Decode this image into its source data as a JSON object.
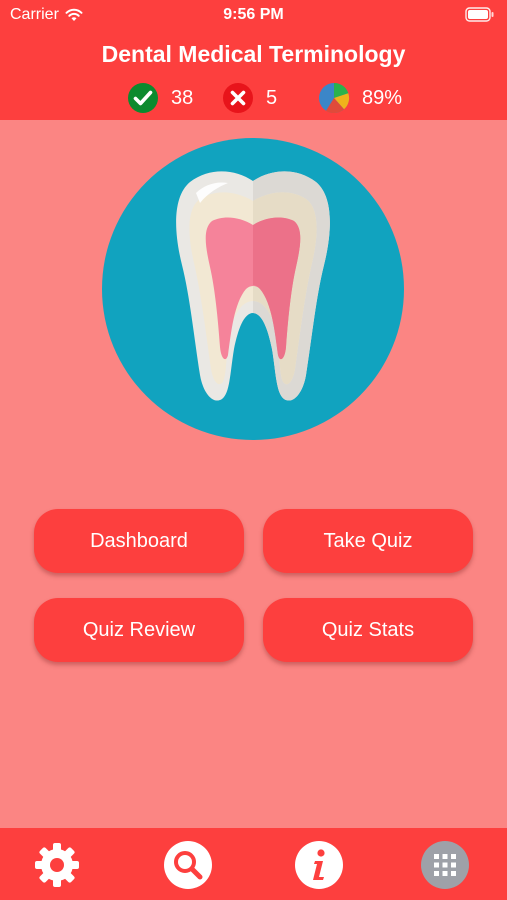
{
  "status_bar": {
    "carrier": "Carrier",
    "time": "9:56 PM"
  },
  "header": {
    "title": "Dental Medical Terminology",
    "stats": {
      "correct": "38",
      "wrong": "5",
      "percent": "89%"
    }
  },
  "hero": {
    "icon": "tooth-icon"
  },
  "menu": {
    "dashboard": "Dashboard",
    "take_quiz": "Take Quiz",
    "quiz_review": "Quiz Review",
    "quiz_stats": "Quiz Stats"
  },
  "tabbar": {
    "items": [
      "gear-icon",
      "search-icon",
      "info-icon",
      "apps-grid-icon"
    ]
  },
  "colors": {
    "primary_red": "#fd3f3e",
    "background_pink": "#fb8583",
    "hero_teal": "#11a3bf",
    "correct_green": "#0c8a2e",
    "wrong_red": "#e8141b"
  }
}
